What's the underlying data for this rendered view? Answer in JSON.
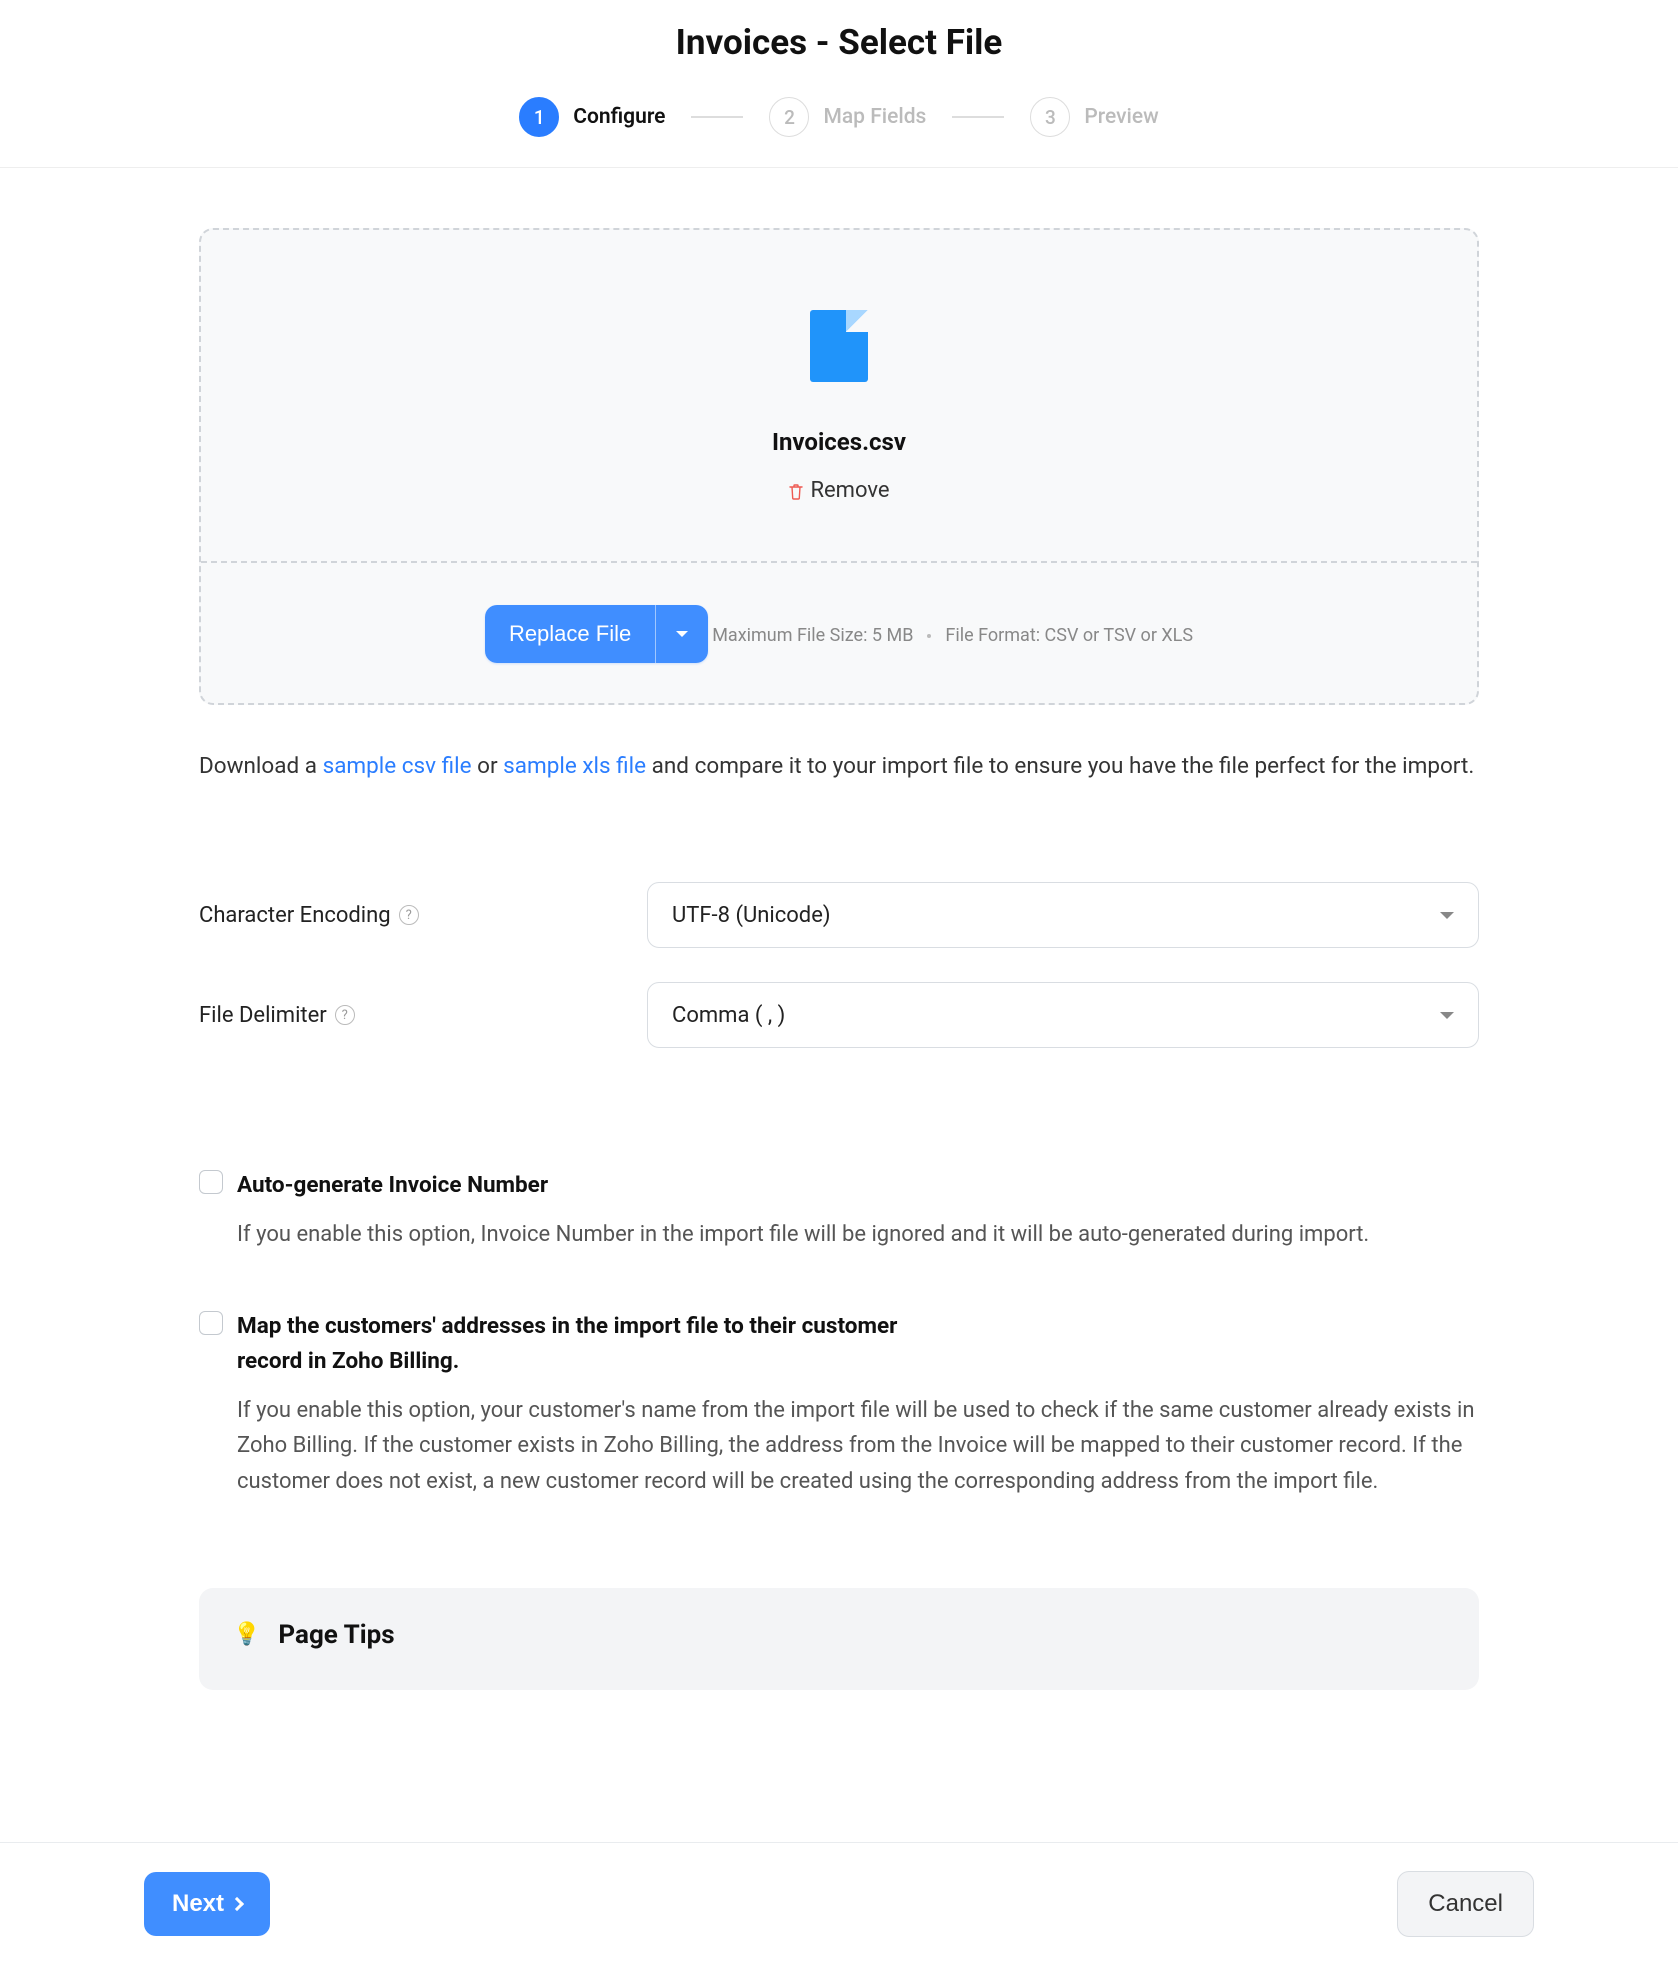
{
  "header": {
    "title": "Invoices - Select File"
  },
  "stepper": {
    "steps": [
      {
        "num": "1",
        "label": "Configure",
        "active": true
      },
      {
        "num": "2",
        "label": "Map Fields",
        "active": false
      },
      {
        "num": "3",
        "label": "Preview",
        "active": false
      }
    ]
  },
  "upload": {
    "file_name": "Invoices.csv",
    "remove_label": "Remove",
    "replace_label": "Replace File",
    "max_size_text": "Maximum File Size: 5 MB",
    "format_text": "File Format: CSV or TSV or XLS"
  },
  "instruction": {
    "prefix": "Download a ",
    "csv_link": "sample csv file",
    "middle": " or ",
    "xls_link": "sample xls file",
    "suffix": " and compare it to your import file to ensure you have the file perfect for the import."
  },
  "form": {
    "encoding_label": "Character Encoding",
    "encoding_value": "UTF-8 (Unicode)",
    "delimiter_label": "File Delimiter",
    "delimiter_value": "Comma ( , )"
  },
  "options": {
    "autogen": {
      "label": "Auto-generate Invoice Number",
      "desc": "If you enable this option, Invoice Number in the import file will be ignored and it will be auto-generated during import."
    },
    "map_address": {
      "label": "Map the customers' addresses in the import file to their customer record in Zoho Billing.",
      "desc": "If you enable this option, your customer's name from the import file will be used to check if the same customer already exists in Zoho Billing. If the customer exists in Zoho Billing, the address from the Invoice will be mapped to their customer record. If the customer does not exist, a new customer record will be created using the corresponding address from the import file."
    }
  },
  "tips": {
    "heading": "Page Tips"
  },
  "footer": {
    "next_label": "Next",
    "cancel_label": "Cancel"
  }
}
